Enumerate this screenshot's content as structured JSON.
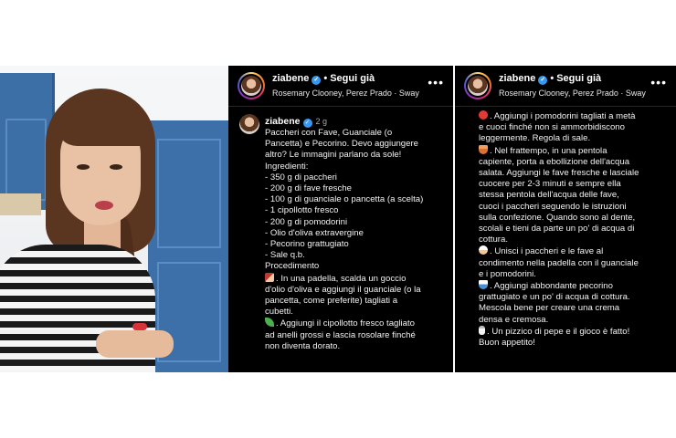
{
  "colors": {
    "panel_bg": "#000000",
    "verified_blue": "#3897f0",
    "cabinet_blue": "#3c6fa6"
  },
  "post": {
    "username": "ziabene",
    "follow_label": "Segui già",
    "music": "Rosemary Clooney, Perez Prado · Sway",
    "more_icon": "more-horizontal-icon",
    "verified_icon": "verified-badge-icon",
    "caption_time": "2 g"
  },
  "caption_left": [
    "Paccheri con Fave, Guanciale (o",
    "Pancetta) e Pecorino. Devo aggiungere",
    "altro? Le immagini parlano da sole!",
    " Ingredienti:",
    "- 350 g di paccheri",
    "- 200 g di fave fresche",
    "- 100 g di guanciale o pancetta (a scelta)",
    "- 1 cipollotto fresco",
    "- 200 g di pomodorini",
    "- Olio d'oliva extravergine",
    "- Pecorino grattugiato",
    "- Sale q.b.",
    "Procedimento",
    ". In una padella, scalda un goccio",
    "d'olio d'oliva e aggiungi il guanciale (o la",
    "pancetta, come preferite) tagliati a",
    "cubetti.",
    ". Aggiungi il cipollotto fresco tagliato",
    "ad anelli grossi e lascia rosolare finché",
    "non diventa dorato."
  ],
  "caption_right": [
    ". Aggiungi i pomodorini tagliati a metà",
    "e cuoci finché non si ammorbidiscono",
    "leggermente. Regola di sale.",
    ". Nel frattempo, in una pentola",
    "capiente, porta a ebollizione dell'acqua",
    "salata. Aggiungi le fave fresche e lasciale",
    "cuocere per 2-3 minuti e  sempre ella",
    "stessa pentola dell'acqua delle fave,",
    "cuoci i paccheri seguendo le istruzioni",
    "sulla confezione. Quando sono al dente,",
    "scolali e tieni da parte un po' di acqua di",
    "cottura.",
    ". Unisci i paccheri e le fave al",
    "condimento nella padella con il guanciale",
    "e i pomodorini.",
    ". Aggiungi abbondante pecorino",
    "grattugiato e un po' di acqua di cottura.",
    "Mescola bene per creare una crema",
    "densa e cremosa.",
    ". Un pizzico di pepe e il gioco è fatto!",
    "Buon appetito!"
  ]
}
